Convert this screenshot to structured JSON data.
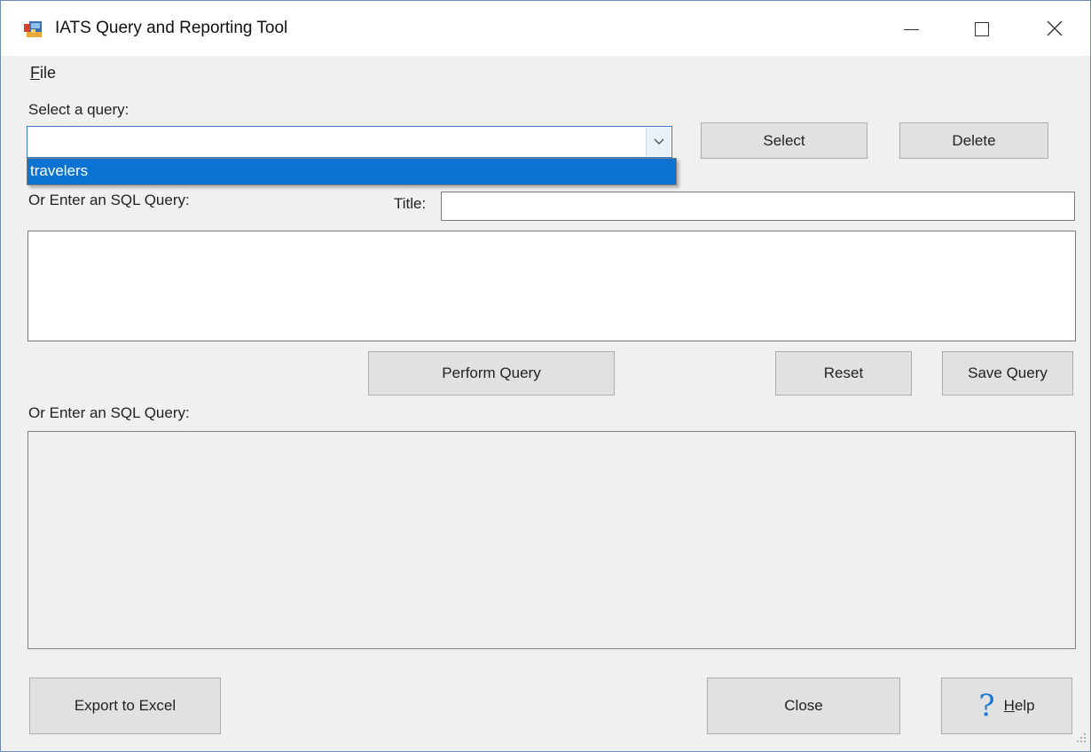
{
  "window": {
    "title": "IATS Query and Reporting Tool",
    "icon": "app-icon",
    "controls": [
      "minimize-icon",
      "maximize-icon",
      "close-icon"
    ]
  },
  "menu": {
    "file_mnemonic": "F",
    "file_rest": "ile"
  },
  "query_select": {
    "label": "Select a query:",
    "value": "",
    "options": [
      "travelers"
    ],
    "highlighted_option": "travelers",
    "select_label": "Select",
    "delete_label": "Delete"
  },
  "sql_entry": {
    "label": "Or Enter an SQL Query:",
    "title_label": "Title:",
    "title_value": "",
    "query_value": "",
    "perform_label": "Perform Query",
    "reset_label": "Reset",
    "save_label": "Save Query"
  },
  "results": {
    "label": "Or Enter an SQL Query:"
  },
  "footer": {
    "export_label": "Export to Excel",
    "close_label": "Close",
    "help_icon": "?",
    "help_mnemonic": "H",
    "help_rest": "elp"
  },
  "colors": {
    "accent": "#0a72d1",
    "button_face": "#e1e1e1",
    "window_bg": "#f0f0f0",
    "help_icon": "#1f78d1"
  }
}
